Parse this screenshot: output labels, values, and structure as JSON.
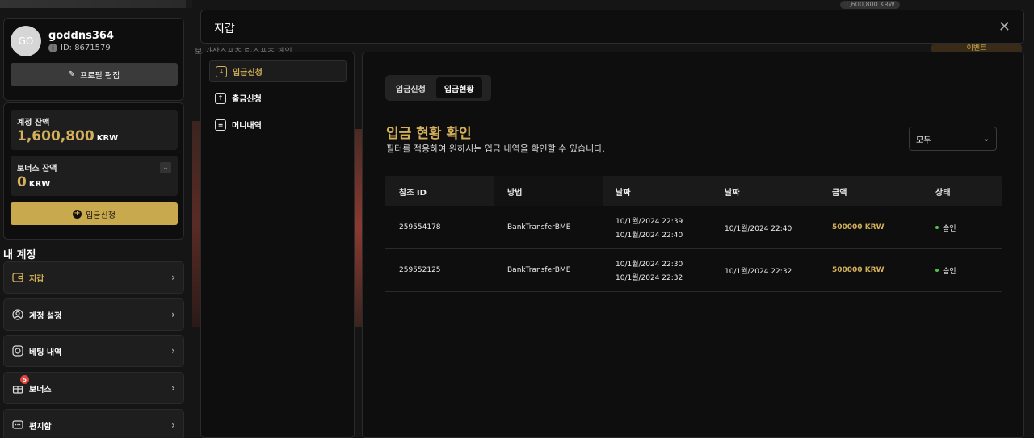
{
  "profile": {
    "avatar_initials": "GO",
    "username": "goddns364",
    "user_id": "ID: 8671579",
    "edit_label": "프로필 편집"
  },
  "balance": {
    "account_label": "계정 잔액",
    "account_value": "1,600,800",
    "account_currency": "KRW",
    "bonus_label": "보너스 잔액",
    "bonus_value": "0",
    "bonus_currency": "KRW",
    "deposit_label": "입금신청"
  },
  "my_account": {
    "title": "내 계정",
    "items": [
      {
        "label": "지갑",
        "icon": "wallet-icon"
      },
      {
        "label": "계정 설정",
        "icon": "user-settings-icon"
      },
      {
        "label": "베팅 내역",
        "icon": "bet-history-icon"
      },
      {
        "label": "보너스",
        "icon": "gift-icon",
        "badge": "5"
      },
      {
        "label": "편지함",
        "icon": "mailbox-icon"
      }
    ]
  },
  "modal": {
    "title": "지갑",
    "nav": [
      {
        "label": "입금신청",
        "icon": "download-icon"
      },
      {
        "label": "출금신청",
        "icon": "upload-icon"
      },
      {
        "label": "머니내역",
        "icon": "document-icon"
      }
    ]
  },
  "background": {
    "top_balance": "1,600,800",
    "top_currency": "KRW",
    "breadcrumb": "보  가상스포츠  E-스포츠  게임",
    "event_label": "이벤트"
  },
  "panel": {
    "tabs": [
      "입금신청",
      "입금현황"
    ],
    "title": "입금 현황 확인",
    "subtitle": "필터를 적용하여 원하시는 입금 내역을 확인할 수 있습니다.",
    "filter_value": "모두",
    "columns": [
      "참조 ID",
      "방법",
      "날짜",
      "날짜",
      "금액",
      "상태"
    ],
    "rows": [
      {
        "ref_id": "259554178",
        "method": "BankTransferBME",
        "date1_a": "10/1월/2024 22:39",
        "date1_b": "10/1월/2024 22:40",
        "date2": "10/1월/2024 22:40",
        "amount": "500000 KRW",
        "status": "승인"
      },
      {
        "ref_id": "259552125",
        "method": "BankTransferBME",
        "date1_a": "10/1월/2024 22:30",
        "date1_b": "10/1월/2024 22:32",
        "date2": "10/1월/2024 22:32",
        "amount": "500000 KRW",
        "status": "승인"
      }
    ]
  }
}
